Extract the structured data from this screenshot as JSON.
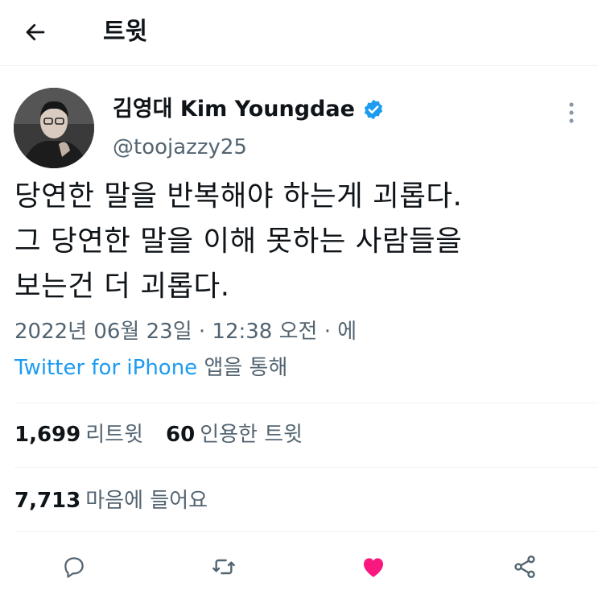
{
  "header": {
    "title": "트윗",
    "back_icon": "arrow-left-icon"
  },
  "tweet": {
    "author": {
      "display_name": "김영대 Kim Youngdae",
      "handle": "@toojazzy25",
      "verified": true,
      "verified_color": "#1d9bf0"
    },
    "text_lines": [
      "당연한 말을 반복해야 하는게 괴롭다.",
      "그 당연한 말을 이해 못하는 사람들을",
      "보는건 더 괴롭다."
    ],
    "meta": "2022년 06월 23일 · 12:38 오전 · 에",
    "source": {
      "link": "Twitter for iPhone",
      "suffix": " 앱을 통해",
      "link_color": "#1d9bf0"
    },
    "stats": {
      "retweets": {
        "count": "1,699",
        "label": "리트윗"
      },
      "quotes": {
        "count": "60",
        "label": "인용한 트윗"
      },
      "likes": {
        "count": "7,713",
        "label": "마음에 들어요"
      }
    },
    "actions": [
      {
        "name": "reply",
        "icon": "comment-icon"
      },
      {
        "name": "retweet",
        "icon": "retweet-icon"
      },
      {
        "name": "like",
        "icon": "heart-icon",
        "active": true,
        "color": "#f91880"
      },
      {
        "name": "share",
        "icon": "share-icon"
      }
    ]
  }
}
